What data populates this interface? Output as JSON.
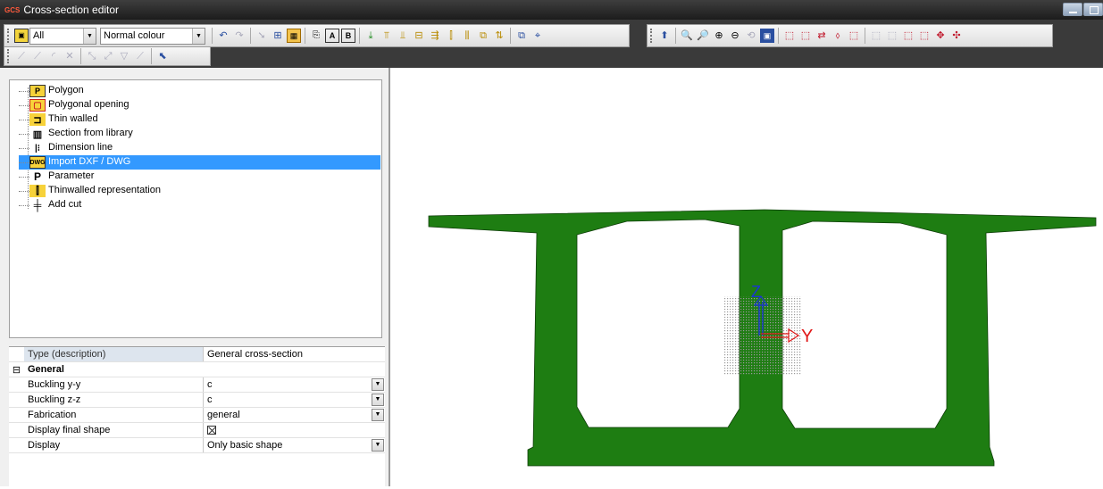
{
  "window": {
    "title": "Cross-section editor",
    "logo": "GCS"
  },
  "toolbar": {
    "filter_combo": "All",
    "colour_combo": "Normal colour"
  },
  "tree": {
    "items": [
      {
        "label": "Polygon",
        "icon": "polygon-icon"
      },
      {
        "label": "Polygonal opening",
        "icon": "polygonal-opening-icon"
      },
      {
        "label": "Thin walled",
        "icon": "thin-walled-icon"
      },
      {
        "label": "Section from library",
        "icon": "section-library-icon"
      },
      {
        "label": "Dimension line",
        "icon": "dimension-line-icon"
      },
      {
        "label": "Import DXF / DWG",
        "icon": "dwg-icon",
        "icon_text": "DWG",
        "selected": true
      },
      {
        "label": "Parameter",
        "icon": "parameter-icon",
        "icon_text": "P"
      },
      {
        "label": "Thinwalled representation",
        "icon": "thinwalled-representation-icon"
      },
      {
        "label": "Add cut",
        "icon": "add-cut-icon"
      }
    ]
  },
  "properties": {
    "header_key": "Type (description)",
    "header_value": "General cross-section",
    "group": "General",
    "rows": [
      {
        "key": "Buckling y-y",
        "value": "c",
        "dropdown": true
      },
      {
        "key": "Buckling z-z",
        "value": "c",
        "dropdown": true
      },
      {
        "key": "Fabrication",
        "value": "general",
        "dropdown": true
      },
      {
        "key": "Display final shape",
        "value": "",
        "checkbox": true
      },
      {
        "key": "Display",
        "value": "Only basic shape",
        "dropdown": true
      }
    ]
  },
  "canvas": {
    "axis_z_label": "Z",
    "axis_y_label": "Y",
    "section_color": "#1e7d12",
    "z_axis_color": "#1a33d6",
    "y_axis_color": "#e01818"
  }
}
